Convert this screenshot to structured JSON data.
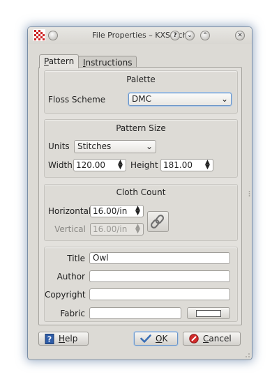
{
  "window": {
    "title": "File Properties – KXStitch",
    "buttons": {
      "help": "?",
      "minimize": "⌄",
      "maximize": "⌃",
      "close": "✕"
    }
  },
  "tabs": [
    {
      "label": "Pattern",
      "accel": "P",
      "rest": "attern",
      "active": true
    },
    {
      "label": "Instructions",
      "accel": "I",
      "rest": "nstructions",
      "active": false
    }
  ],
  "palette": {
    "title": "Palette",
    "floss_label": "Floss Scheme",
    "floss_value": "DMC"
  },
  "pattern_size": {
    "title": "Pattern Size",
    "units_label": "Units",
    "units_value": "Stitches",
    "width_label": "Width",
    "width_value": "120.00",
    "height_label": "Height",
    "height_value": "181.00"
  },
  "cloth_count": {
    "title": "Cloth Count",
    "horizontal_label": "Horizontal",
    "horizontal_value": "16.00/in",
    "vertical_label": "Vertical",
    "vertical_value": "16.00/in"
  },
  "properties": {
    "title_label": "Title",
    "title_value": "Owl",
    "author_label": "Author",
    "author_value": "",
    "copyright_label": "Copyright",
    "copyright_value": "",
    "fabric_label": "Fabric",
    "fabric_value": "",
    "fabric_color": "#ffffff"
  },
  "footer": {
    "help": {
      "accel": "H",
      "rest": "elp"
    },
    "ok": {
      "accel": "O",
      "rest": "K"
    },
    "cancel": {
      "accel": "C",
      "rest": "ancel"
    }
  },
  "colors": {
    "focus": "#6a95c8",
    "window_bg": "#dcdad5"
  }
}
